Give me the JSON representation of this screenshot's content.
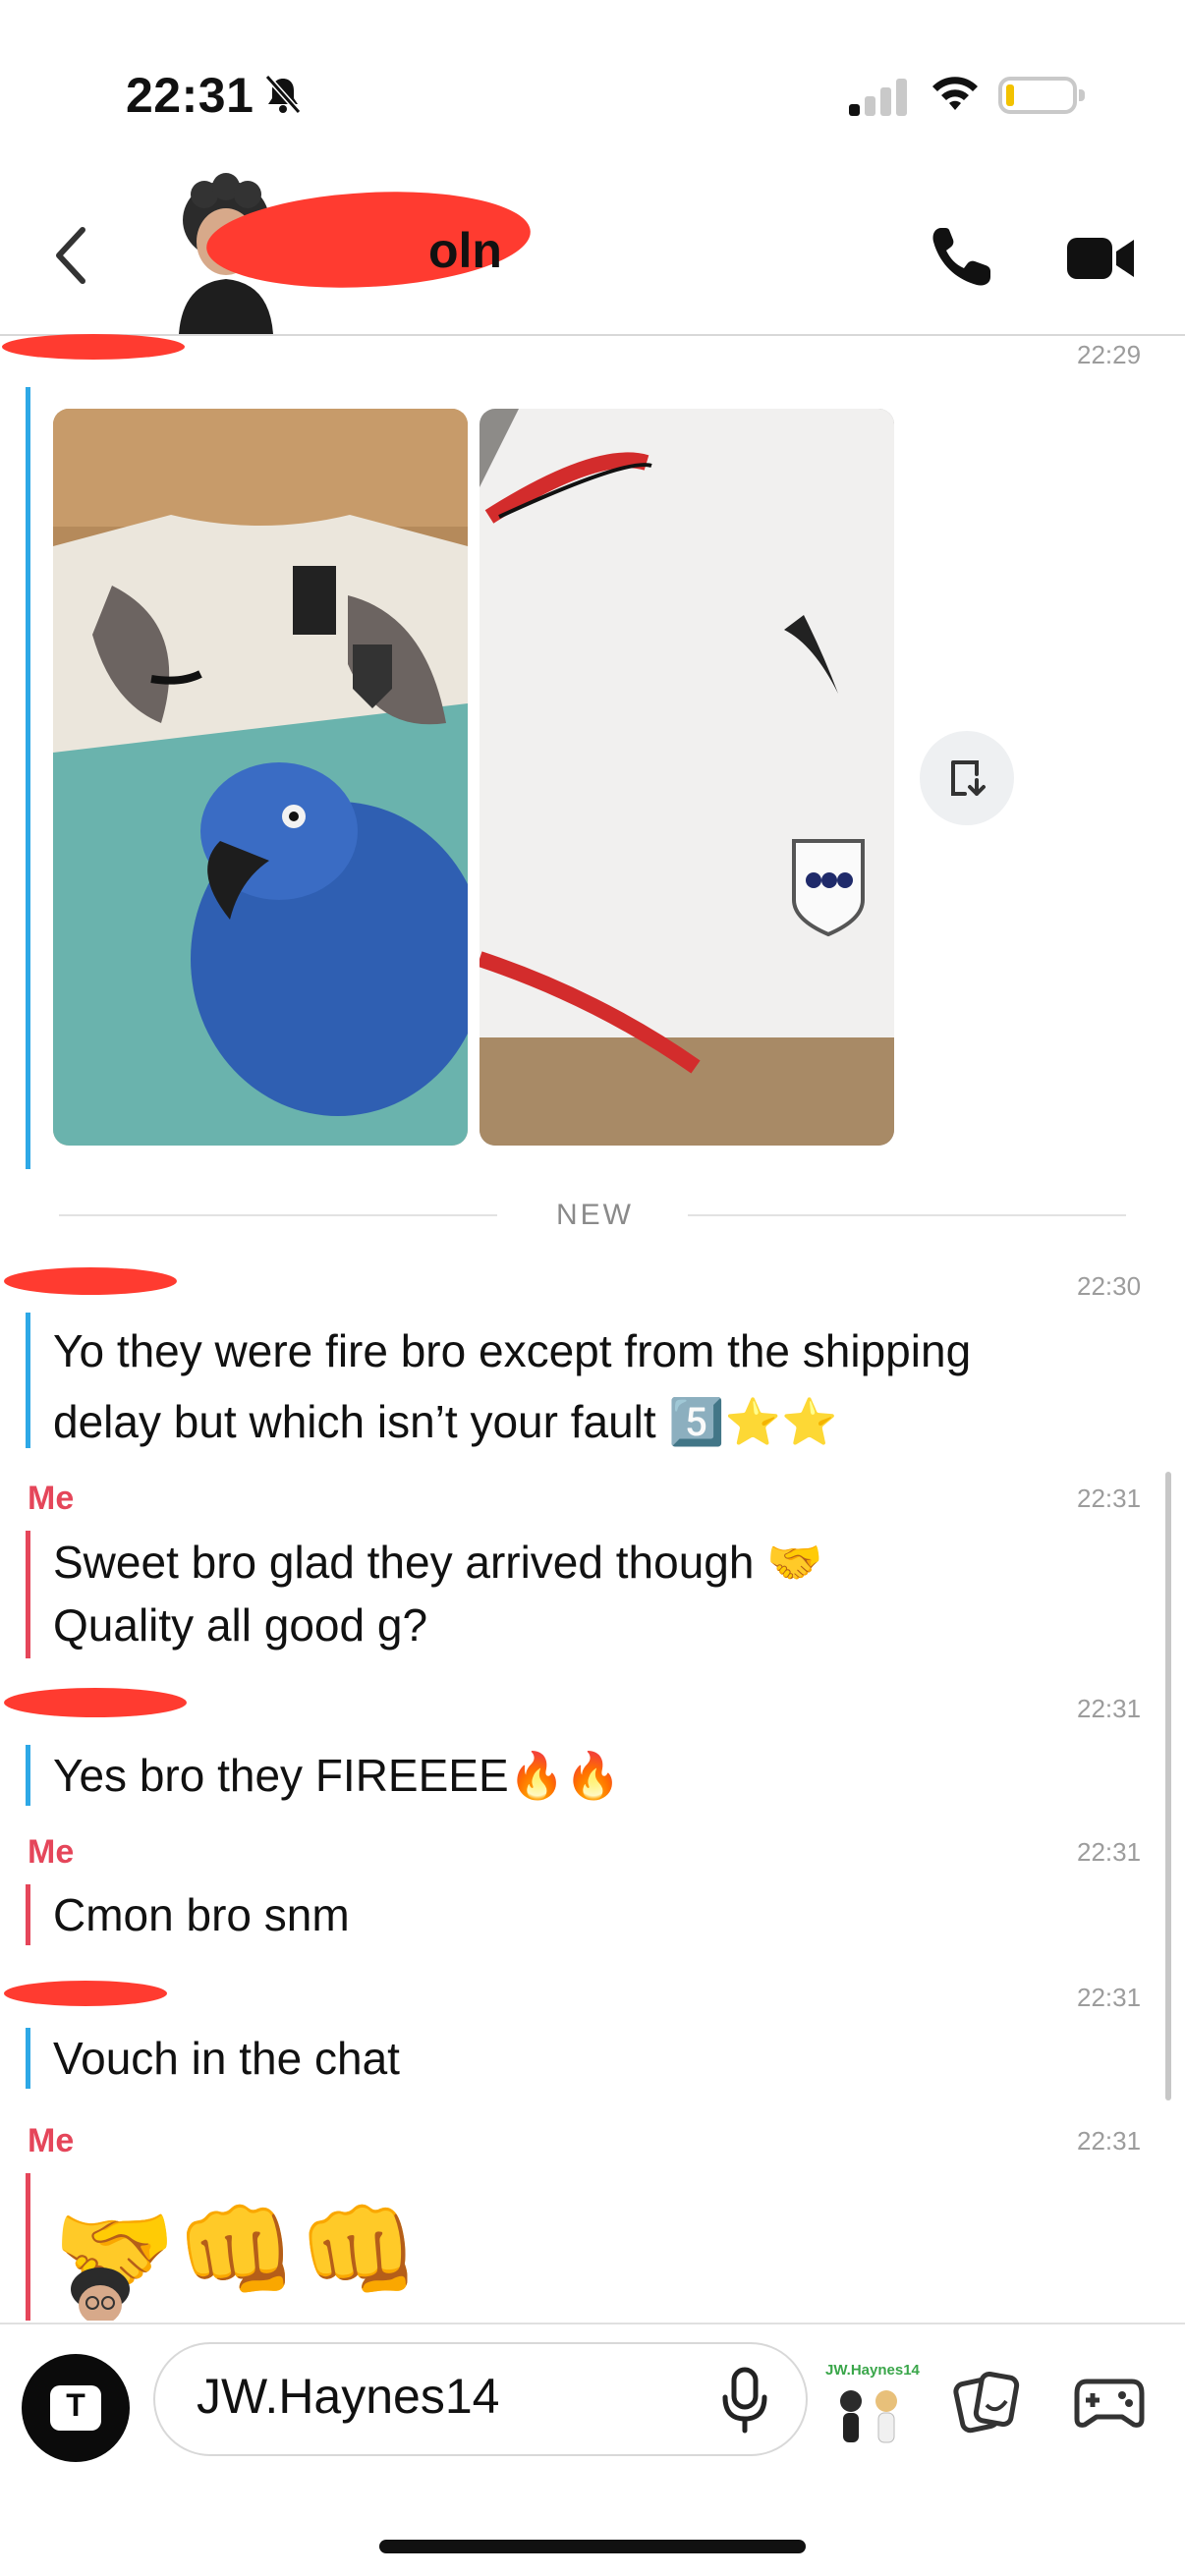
{
  "status_bar": {
    "time": "22:31",
    "signal_bars": 4,
    "signal_active": 1
  },
  "header": {
    "contact_name_visible": "oln"
  },
  "chat": {
    "first_timestamp": "22:29",
    "new_divider": "NEW",
    "messages": [
      {
        "timestamp": "22:30",
        "lines": [
          "Yo they were fire bro except from the shipping",
          "delay but which isn’t your fault 5️⃣⭐️⭐️"
        ]
      },
      {
        "sender": "Me",
        "timestamp": "22:31",
        "lines": [
          "Sweet bro glad they arrived though 🤝",
          "Quality all good g?"
        ]
      },
      {
        "timestamp": "22:31",
        "lines": [
          "Yes bro they FIREEEE🔥🔥"
        ]
      },
      {
        "sender": "Me",
        "timestamp": "22:31",
        "lines": [
          "Cmon bro snm"
        ]
      },
      {
        "timestamp": "22:31",
        "lines": [
          "Vouch in the chat"
        ]
      },
      {
        "sender": "Me",
        "timestamp": "22:31",
        "lines": [
          "🤝👊👊"
        ]
      }
    ]
  },
  "composer": {
    "camera_letter": "T",
    "input_value": "JW.Haynes14",
    "bitmoji_label": "JW.Haynes14"
  },
  "colors": {
    "friend_bar": "#2ea8e6",
    "me": "#e5465a",
    "redaction": "#ff3b30"
  }
}
